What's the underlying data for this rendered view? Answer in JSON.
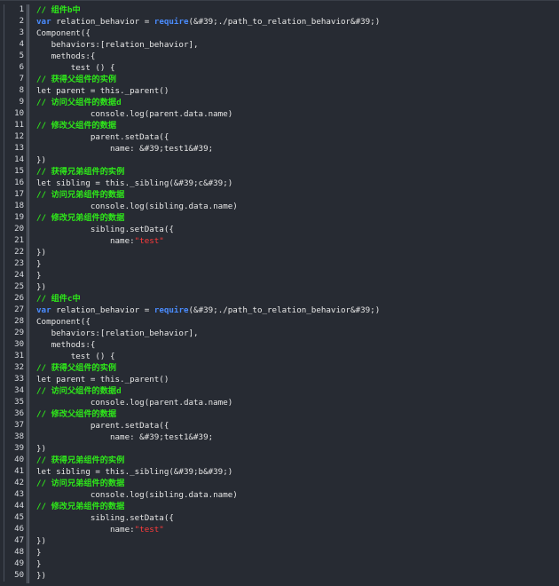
{
  "colors": {
    "background": "#272b33",
    "text": "#e6e6e6",
    "comment": "#2ee61a",
    "keyword": "#4a8cff",
    "string": "#ff3b3b",
    "line_number": "#d8dbe0"
  },
  "lines": [
    {
      "n": "1",
      "segments": [
        {
          "t": "comment",
          "v": "// 组件b中"
        }
      ]
    },
    {
      "n": "2",
      "segments": [
        {
          "t": "keyword",
          "v": "var"
        },
        {
          "t": "plain",
          "v": " relation_behavior = "
        },
        {
          "t": "keyword",
          "v": "require"
        },
        {
          "t": "plain",
          "v": "(&#39;./path_to_relation_behavior&#39;)"
        }
      ]
    },
    {
      "n": "3",
      "segments": [
        {
          "t": "plain",
          "v": "Component({"
        }
      ]
    },
    {
      "n": "4",
      "segments": [
        {
          "t": "plain",
          "v": "   behaviors:[relation_behavior],"
        }
      ]
    },
    {
      "n": "5",
      "segments": [
        {
          "t": "plain",
          "v": "   methods:{"
        }
      ]
    },
    {
      "n": "6",
      "segments": [
        {
          "t": "plain",
          "v": "       test () {"
        }
      ]
    },
    {
      "n": "7",
      "segments": [
        {
          "t": "comment",
          "v": "// 获得父组件的实例"
        }
      ]
    },
    {
      "n": "8",
      "segments": [
        {
          "t": "plain",
          "v": "let parent = this._parent()"
        }
      ]
    },
    {
      "n": "9",
      "segments": [
        {
          "t": "comment",
          "v": "// 访问父组件的数据d"
        }
      ]
    },
    {
      "n": "10",
      "segments": [
        {
          "t": "plain",
          "v": "           console.log(parent.data.name)"
        }
      ]
    },
    {
      "n": "11",
      "segments": [
        {
          "t": "comment",
          "v": "// 修改父组件的数据"
        }
      ]
    },
    {
      "n": "12",
      "segments": [
        {
          "t": "plain",
          "v": "           parent.setData({"
        }
      ]
    },
    {
      "n": "13",
      "segments": [
        {
          "t": "plain",
          "v": "               name: &#39;test1&#39;"
        }
      ]
    },
    {
      "n": "14",
      "segments": [
        {
          "t": "plain",
          "v": "})"
        }
      ]
    },
    {
      "n": "15",
      "segments": [
        {
          "t": "comment",
          "v": "// 获得兄弟组件的实例"
        }
      ]
    },
    {
      "n": "16",
      "segments": [
        {
          "t": "plain",
          "v": "let sibling = this._sibling(&#39;c&#39;)"
        }
      ]
    },
    {
      "n": "17",
      "segments": [
        {
          "t": "comment",
          "v": "// 访问兄弟组件的数据"
        }
      ]
    },
    {
      "n": "18",
      "segments": [
        {
          "t": "plain",
          "v": "           console.log(sibling.data.name)"
        }
      ]
    },
    {
      "n": "19",
      "segments": [
        {
          "t": "comment",
          "v": "// 修改兄弟组件的数据"
        }
      ]
    },
    {
      "n": "20",
      "segments": [
        {
          "t": "plain",
          "v": "           sibling.setData({"
        }
      ]
    },
    {
      "n": "21",
      "segments": [
        {
          "t": "plain",
          "v": "               name:"
        },
        {
          "t": "string",
          "v": "\"test\""
        }
      ]
    },
    {
      "n": "22",
      "segments": [
        {
          "t": "plain",
          "v": "})"
        }
      ]
    },
    {
      "n": "23",
      "segments": [
        {
          "t": "plain",
          "v": "}"
        }
      ]
    },
    {
      "n": "24",
      "segments": [
        {
          "t": "plain",
          "v": "}"
        }
      ]
    },
    {
      "n": "25",
      "segments": [
        {
          "t": "plain",
          "v": "})"
        }
      ]
    },
    {
      "n": "26",
      "segments": [
        {
          "t": "comment",
          "v": "// 组件c中"
        }
      ]
    },
    {
      "n": "27",
      "segments": [
        {
          "t": "keyword",
          "v": "var"
        },
        {
          "t": "plain",
          "v": " relation_behavior = "
        },
        {
          "t": "keyword",
          "v": "require"
        },
        {
          "t": "plain",
          "v": "(&#39;./path_to_relation_behavior&#39;)"
        }
      ]
    },
    {
      "n": "28",
      "segments": [
        {
          "t": "plain",
          "v": "Component({"
        }
      ]
    },
    {
      "n": "29",
      "segments": [
        {
          "t": "plain",
          "v": "   behaviors:[relation_behavior],"
        }
      ]
    },
    {
      "n": "30",
      "segments": [
        {
          "t": "plain",
          "v": "   methods:{"
        }
      ]
    },
    {
      "n": "31",
      "segments": [
        {
          "t": "plain",
          "v": "       test () {"
        }
      ]
    },
    {
      "n": "32",
      "segments": [
        {
          "t": "comment",
          "v": "// 获得父组件的实例"
        }
      ]
    },
    {
      "n": "33",
      "segments": [
        {
          "t": "plain",
          "v": "let parent = this._parent()"
        }
      ]
    },
    {
      "n": "34",
      "segments": [
        {
          "t": "comment",
          "v": "// 访问父组件的数据d"
        }
      ]
    },
    {
      "n": "35",
      "segments": [
        {
          "t": "plain",
          "v": "           console.log(parent.data.name)"
        }
      ]
    },
    {
      "n": "36",
      "segments": [
        {
          "t": "comment",
          "v": "// 修改父组件的数据"
        }
      ]
    },
    {
      "n": "37",
      "segments": [
        {
          "t": "plain",
          "v": "           parent.setData({"
        }
      ]
    },
    {
      "n": "38",
      "segments": [
        {
          "t": "plain",
          "v": "               name: &#39;test1&#39;"
        }
      ]
    },
    {
      "n": "39",
      "segments": [
        {
          "t": "plain",
          "v": "})"
        }
      ]
    },
    {
      "n": "40",
      "segments": [
        {
          "t": "comment",
          "v": "// 获得兄弟组件的实例"
        }
      ]
    },
    {
      "n": "41",
      "segments": [
        {
          "t": "plain",
          "v": "let sibling = this._sibling(&#39;b&#39;)"
        }
      ]
    },
    {
      "n": "42",
      "segments": [
        {
          "t": "comment",
          "v": "// 访问兄弟组件的数据"
        }
      ]
    },
    {
      "n": "43",
      "segments": [
        {
          "t": "plain",
          "v": "           console.log(sibling.data.name)"
        }
      ]
    },
    {
      "n": "44",
      "segments": [
        {
          "t": "comment",
          "v": "// 修改兄弟组件的数据"
        }
      ]
    },
    {
      "n": "45",
      "segments": [
        {
          "t": "plain",
          "v": "           sibling.setData({"
        }
      ]
    },
    {
      "n": "46",
      "segments": [
        {
          "t": "plain",
          "v": "               name:"
        },
        {
          "t": "string",
          "v": "\"test\""
        }
      ]
    },
    {
      "n": "47",
      "segments": [
        {
          "t": "plain",
          "v": "})"
        }
      ]
    },
    {
      "n": "48",
      "segments": [
        {
          "t": "plain",
          "v": "}"
        }
      ]
    },
    {
      "n": "49",
      "segments": [
        {
          "t": "plain",
          "v": "}"
        }
      ]
    },
    {
      "n": "50",
      "segments": [
        {
          "t": "plain",
          "v": "})"
        }
      ]
    }
  ]
}
